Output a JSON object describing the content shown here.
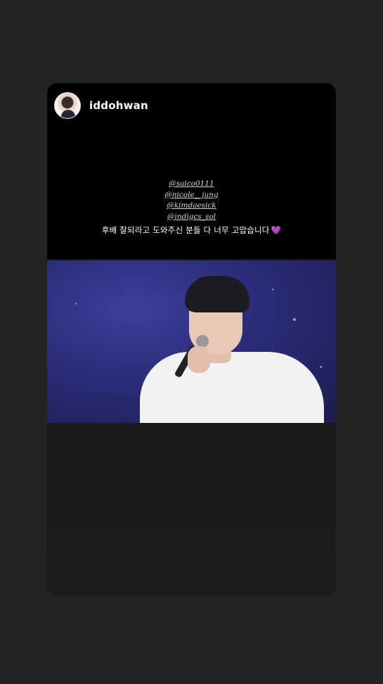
{
  "story": {
    "username": "iddohwan",
    "mentions": [
      "@saico0111",
      "@nicole__jung",
      "@kimdaesick",
      "@indigcs_sol"
    ],
    "caption": "후배 잘되라고 도와주신 분들 다 너무 고맙습니다",
    "heart_emoji": "💜"
  },
  "icons": {
    "avatar": "profile-avatar",
    "heart": "purple-heart-icon"
  },
  "colors": {
    "background": "#232323",
    "heart": "#9b59d6",
    "stage": "#2a2c78"
  }
}
